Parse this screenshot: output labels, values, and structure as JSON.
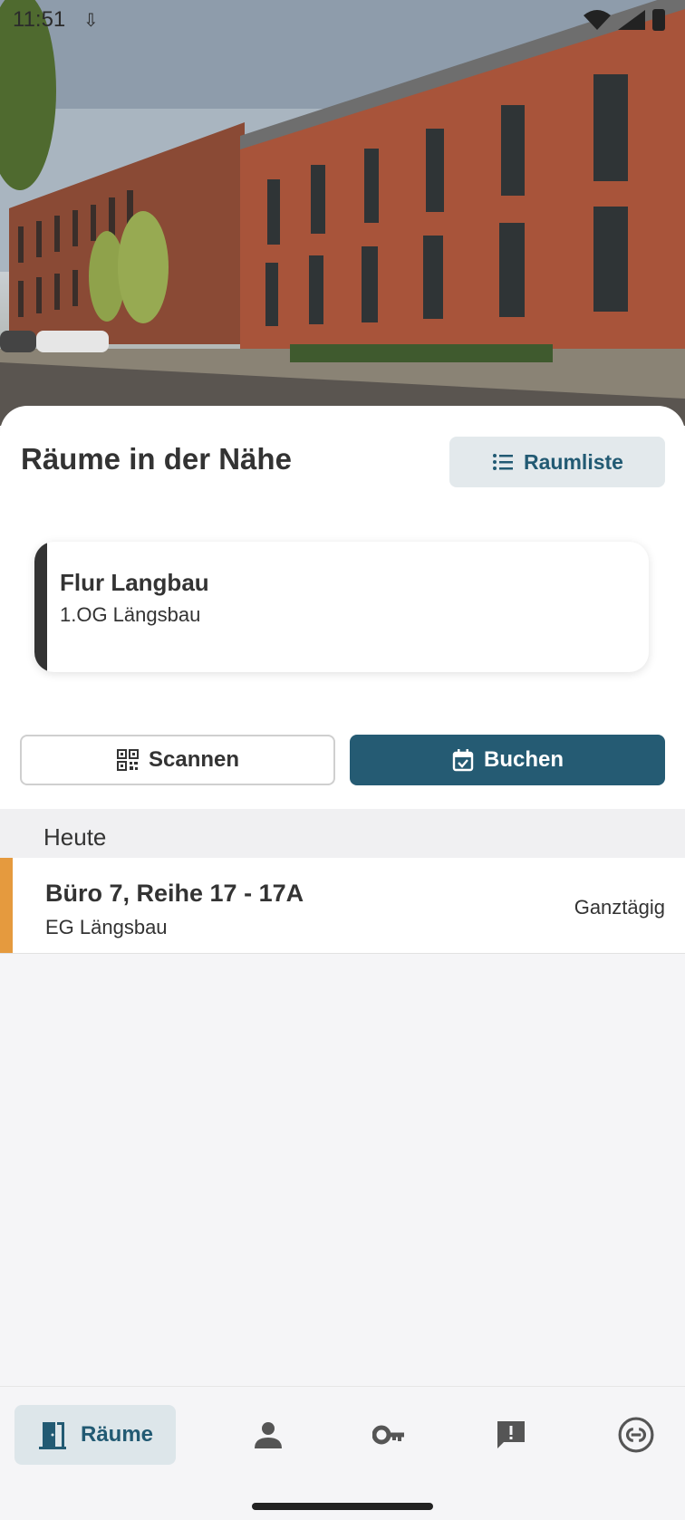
{
  "status_bar": {
    "time": "11:51",
    "download_icon": "download-icon"
  },
  "nearby": {
    "title": "Räume in der Nähe",
    "room_list_button": "Raumliste",
    "card": {
      "name": "Flur Langbau",
      "location": "1.OG Längsbau",
      "accent_color": "#333333"
    },
    "scan_button": "Scannen",
    "book_button": "Buchen"
  },
  "today": {
    "header": "Heute",
    "bookings": [
      {
        "name": "Büro 7, Reihe 17 - 17A",
        "location": "EG Längsbau",
        "time": "Ganztägig",
        "accent_color": "#e59a3e"
      }
    ]
  },
  "bottom_nav": {
    "items": [
      {
        "icon": "door-icon",
        "label": "Räume",
        "active": true
      },
      {
        "icon": "person-icon",
        "label": "",
        "active": false
      },
      {
        "icon": "key-icon",
        "label": "",
        "active": false
      },
      {
        "icon": "feedback-icon",
        "label": "",
        "active": false
      },
      {
        "icon": "link-icon",
        "label": "",
        "active": false
      }
    ]
  },
  "colors": {
    "primary": "#255b73",
    "secondary_bg": "#e3e9ec",
    "booking_accent": "#e59a3e"
  }
}
